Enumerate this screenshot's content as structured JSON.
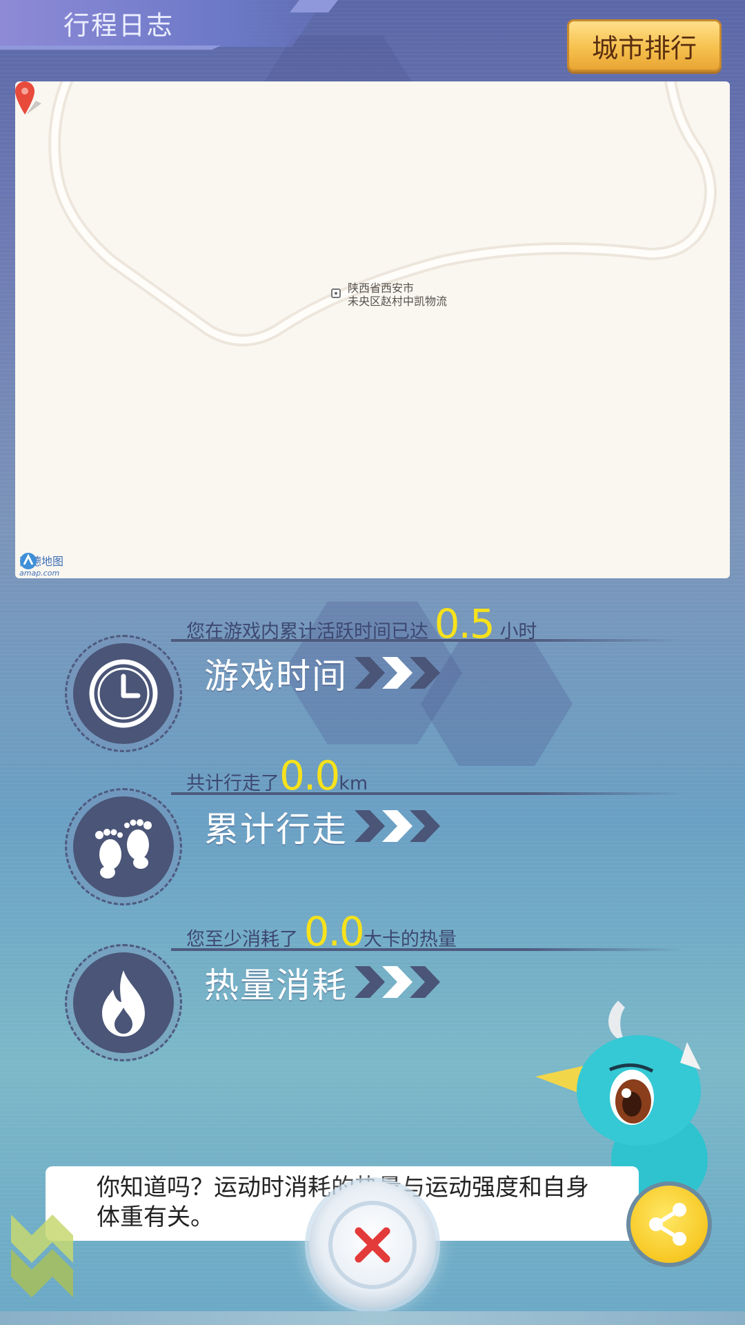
{
  "header": {
    "title": "行程日志",
    "rank_button": "城市排行"
  },
  "map": {
    "location_line1": "陕西省西安市",
    "location_line2": "未央区赵村中凯物流",
    "provider_cn": "高德地图",
    "provider_en": "amap.com"
  },
  "stats": [
    {
      "prefix": "您在游戏内累计活跃时间已达",
      "value": "0.5",
      "suffix": "小时",
      "label": "游戏时间",
      "icon": "clock-icon"
    },
    {
      "prefix": "共计行走了",
      "value": "0.0",
      "suffix": "km",
      "label": "累计行走",
      "icon": "footprints-icon"
    },
    {
      "prefix": "您至少消耗了",
      "value": "0.0",
      "suffix": "大卡的热量",
      "label": "热量消耗",
      "icon": "flame-icon"
    }
  ],
  "tip": {
    "text": "你知道吗？运动时消耗的热量与运动强度和自身体重有关。"
  },
  "colors": {
    "accent_yellow": "#f7e21b",
    "button_gold": "#f6c14e",
    "icon_dark": "#4a5577"
  }
}
